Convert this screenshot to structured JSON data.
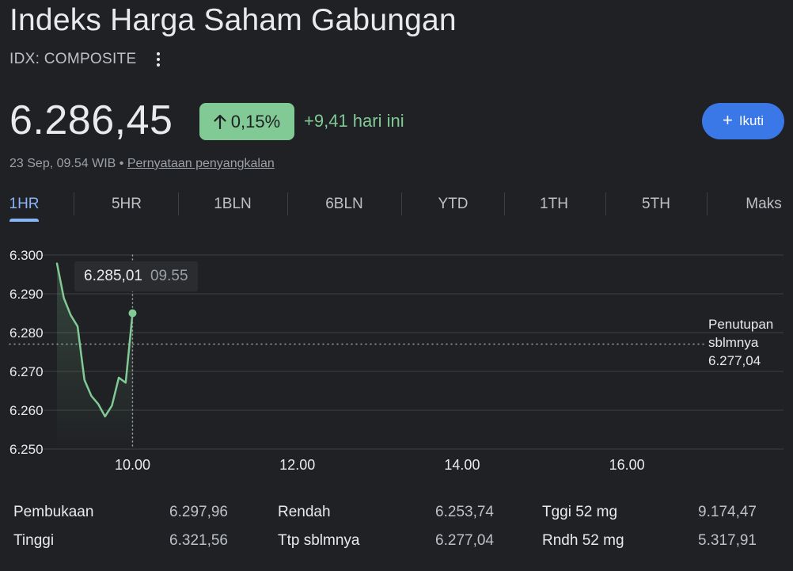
{
  "header": {
    "title": "Indeks Harga Saham Gabungan",
    "subtitle": "IDX: COMPOSITE"
  },
  "quote": {
    "price": "6.286,45",
    "change_pct": "0,15%",
    "change_abs": "+9,41 hari ini",
    "follow_label": "Ikuti",
    "timestamp": "23 Sep, 09.54 WIB",
    "separator": "•",
    "disclaimer": "Pernyataan penyangkalan"
  },
  "tabs": [
    {
      "label": "1HR",
      "active": true
    },
    {
      "label": "5HR"
    },
    {
      "label": "1BLN"
    },
    {
      "label": "6BLN"
    },
    {
      "label": "YTD"
    },
    {
      "label": "1TH"
    },
    {
      "label": "5TH"
    },
    {
      "label": "Maks"
    }
  ],
  "tooltip": {
    "value": "6.285,01",
    "time": "09.55"
  },
  "prev_close": {
    "line1": "Penutupan",
    "line2": "sblmnya",
    "value": "6.277,04"
  },
  "colors": {
    "background": "#202124",
    "up": "#81c995",
    "accent": "#8ab4f8",
    "button": "#3b78e7"
  },
  "icons": {
    "more": "more-vert-icon",
    "arrow": "arrow-up-icon",
    "plus": "plus-icon"
  },
  "chart_data": {
    "type": "line",
    "y_tick_labels": [
      "6.300",
      "6.290",
      "6.280",
      "6.270",
      "6.260",
      "6.250"
    ],
    "y_ticks": [
      6300,
      6290,
      6280,
      6270,
      6260,
      6250
    ],
    "ylim": [
      6250,
      6300
    ],
    "x_tick_labels": [
      "10.00",
      "12.00",
      "14.00",
      "16.00"
    ],
    "x_ticks": [
      10,
      12,
      14,
      16
    ],
    "xlim": [
      9.083,
      17.9
    ],
    "reference_line": 6277.04,
    "grid": true,
    "x": [
      9.083,
      9.2,
      9.33,
      9.45,
      9.55,
      9.65,
      9.73,
      9.82,
      9.9,
      9.95,
      10.0
    ],
    "values": [
      6297.8,
      6288.9,
      6284.5,
      6281.6,
      6267.8,
      6263.7,
      6261.6,
      6258.4,
      6261.2,
      6268.4,
      6267.1,
      6285.0
    ]
  },
  "stats": [
    {
      "label": "Pembukaan",
      "value": "6.297,96"
    },
    {
      "label": "Tinggi",
      "value": "6.321,56"
    },
    {
      "label": "Rendah",
      "value": "6.253,74"
    },
    {
      "label": "Ttp sblmnya",
      "value": "6.277,04"
    },
    {
      "label": "Tggi 52 mg",
      "value": "9.174,47"
    },
    {
      "label": "Rndh 52 mg",
      "value": "5.317,91"
    }
  ]
}
